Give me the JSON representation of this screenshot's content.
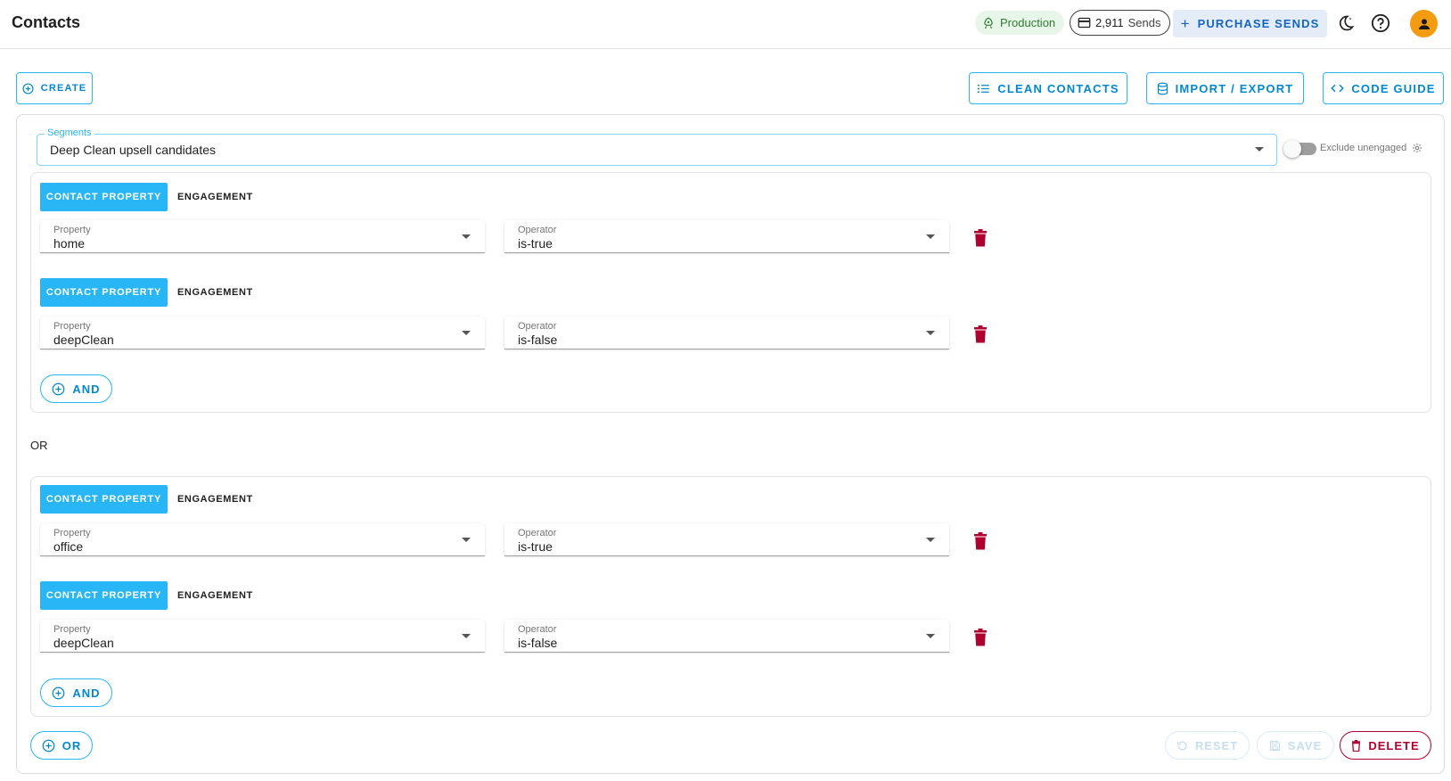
{
  "app": {
    "title": "Contacts"
  },
  "header": {
    "environment": "Production",
    "sends_count": "2,911",
    "sends_label": "Sends",
    "purchase_label": "PURCHASE SENDS"
  },
  "toolbar": {
    "create_label": "CREATE",
    "clean_label": "CLEAN CONTACTS",
    "import_export_label": "IMPORT / EXPORT",
    "code_guide_label": "CODE GUIDE"
  },
  "segments": {
    "label": "Segments",
    "selected": "Deep Clean upsell candidates",
    "exclude_unengaged_label": "Exclude unengaged",
    "exclude_unengaged_on": false
  },
  "filter_groups": [
    {
      "conditions": [
        {
          "tab_active": "CONTACT PROPERTY",
          "tab_other": "ENGAGEMENT",
          "property_label": "Property",
          "property": "home",
          "operator_label": "Operator",
          "operator": "is-true"
        },
        {
          "tab_active": "CONTACT PROPERTY",
          "tab_other": "ENGAGEMENT",
          "property_label": "Property",
          "property": "deepClean",
          "operator_label": "Operator",
          "operator": "is-false"
        }
      ],
      "and_label": "AND"
    },
    {
      "conditions": [
        {
          "tab_active": "CONTACT PROPERTY",
          "tab_other": "ENGAGEMENT",
          "property_label": "Property",
          "property": "office",
          "operator_label": "Operator",
          "operator": "is-true"
        },
        {
          "tab_active": "CONTACT PROPERTY",
          "tab_other": "ENGAGEMENT",
          "property_label": "Property",
          "property": "deepClean",
          "operator_label": "Operator",
          "operator": "is-false"
        }
      ],
      "and_label": "AND"
    }
  ],
  "or_separator": "OR",
  "footer": {
    "or_label": "OR",
    "reset_label": "RESET",
    "save_label": "SAVE",
    "delete_label": "DELETE"
  },
  "colors": {
    "accent": "#29b6f6",
    "danger": "#b0002e",
    "avatar": "#f39c12",
    "env_chip_bg": "#e8f5e9"
  }
}
